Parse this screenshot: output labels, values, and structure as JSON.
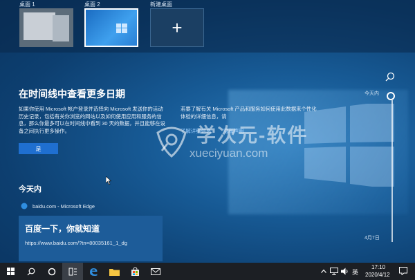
{
  "desktops": [
    {
      "label": "桌面 1"
    },
    {
      "label": "桌面 2"
    },
    {
      "label": "新建桌面"
    }
  ],
  "timeline": {
    "headline": "在时间线中查看更多日期",
    "left_paragraph": "如果你使用 Microsoft 帐户登录并选择向 Microsoft 发送你的活动历史记录，包括有关你浏览的网站以及如何使用应用和服务的信息，那么你最多可以在时间线中看到 30 天的数据，并且能够在设备之间执行更多操作。",
    "right_paragraph": "若要了解有关 Microsoft 产品和服务如何使用此数据来个性化体验的详细信息，请",
    "yes_label": "是",
    "learn_more": "了解详细信息",
    "privacy": "隐私声明",
    "today_title": "今天内",
    "scrubber_today": "今天内",
    "scrubber_date": "4月7日"
  },
  "activity": {
    "app": "baidu.com - Microsoft Edge",
    "title": "百度一下，你就知道",
    "url": "https://www.baidu.com/?tn=80035161_1_dg"
  },
  "watermark": {
    "line1": "学次元-软件",
    "line2": "xueciyuan.com"
  },
  "taskbar": {
    "tray_lang": "英",
    "time": "17:10",
    "date": "2020/4/12"
  }
}
